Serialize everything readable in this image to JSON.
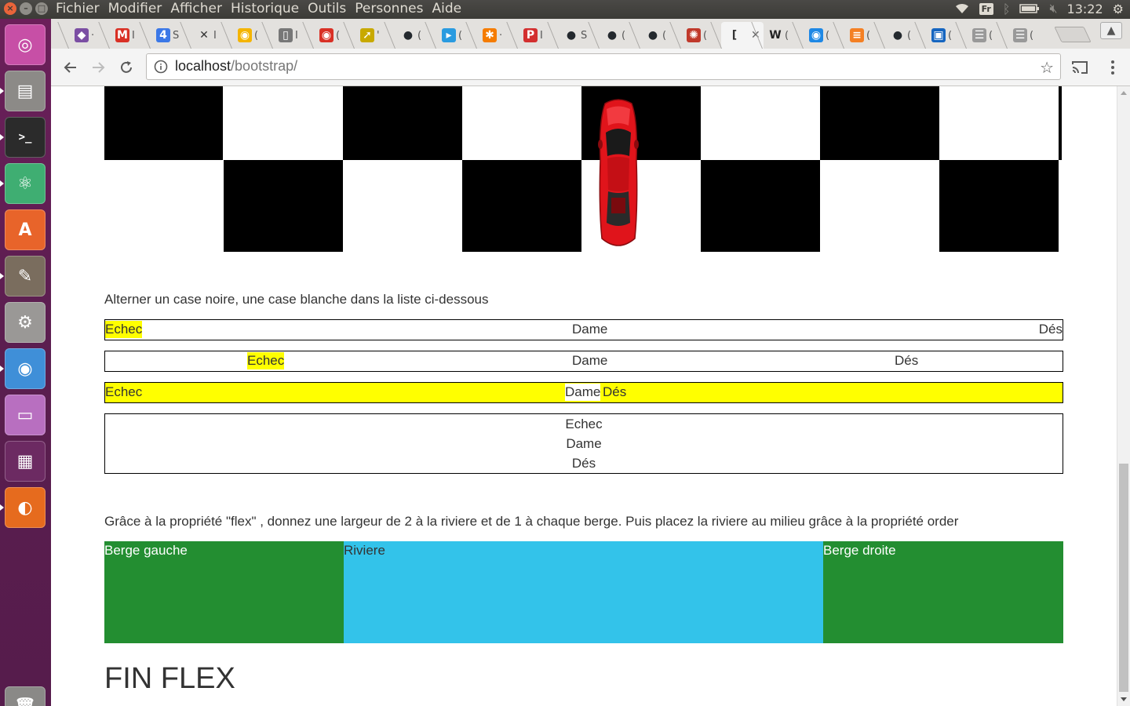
{
  "panel": {
    "menu": [
      "Fichier",
      "Modifier",
      "Afficher",
      "Historique",
      "Outils",
      "Personnes",
      "Aide"
    ],
    "keyboard_layout": "Fr",
    "clock": "13:22"
  },
  "launcher": {
    "apps": [
      {
        "name": "ubuntu-dash",
        "color": "#c74fa6",
        "running": false
      },
      {
        "name": "files",
        "color": "#8c8a87",
        "running": true
      },
      {
        "name": "terminal",
        "color": "#2b2b2b",
        "running": true
      },
      {
        "name": "atom",
        "color": "#3fae72",
        "running": true
      },
      {
        "name": "software-center",
        "color": "#e8642a",
        "running": false
      },
      {
        "name": "gimp",
        "color": "#7a6d5e",
        "running": true
      },
      {
        "name": "system-settings",
        "color": "#9a9896",
        "running": false
      },
      {
        "name": "chromium",
        "color": "#3f8fd8",
        "running": true
      },
      {
        "name": "app-window",
        "color": "#b86fc0",
        "running": false
      },
      {
        "name": "workspace-switcher",
        "color": "#6c2a62",
        "running": false
      },
      {
        "name": "firefox",
        "color": "#e66b1e",
        "running": true
      },
      {
        "name": "trash",
        "color": "#8a8987",
        "running": false
      }
    ]
  },
  "browser": {
    "tabs": [
      {
        "icon": "purple-shield-icon",
        "glyph": "◆",
        "color": "#7b4ea3",
        "cut": "·"
      },
      {
        "icon": "gmail-icon",
        "glyph": "M",
        "color": "#d93025",
        "cut": "I"
      },
      {
        "icon": "calendar-icon",
        "glyph": "4",
        "color": "#3b78e7",
        "cut": "S"
      },
      {
        "icon": "grid-icon",
        "glyph": "✕",
        "color": "#333333",
        "cut": "I"
      },
      {
        "icon": "keep-icon",
        "glyph": "◉",
        "color": "#f4b400",
        "cut": "("
      },
      {
        "icon": "doc-icon",
        "glyph": "▯",
        "color": "#777777",
        "cut": "I"
      },
      {
        "icon": "rss-icon",
        "glyph": "◉",
        "color": "#d93025",
        "cut": "("
      },
      {
        "icon": "rocket-icon",
        "glyph": "➚",
        "color": "#c8a900",
        "cut": "'"
      },
      {
        "icon": "github-icon",
        "glyph": "●",
        "color": "#24292e",
        "cut": "("
      },
      {
        "icon": "cursor-icon",
        "glyph": "▸",
        "color": "#2a9be0",
        "cut": "("
      },
      {
        "icon": "asterisk-icon",
        "glyph": "✱",
        "color": "#f57c00",
        "cut": "·"
      },
      {
        "icon": "p-icon",
        "glyph": "P",
        "color": "#d32f2f",
        "cut": "I"
      },
      {
        "icon": "github-icon",
        "glyph": "●",
        "color": "#24292e",
        "cut": "S"
      },
      {
        "icon": "github-icon",
        "glyph": "●",
        "color": "#24292e",
        "cut": "("
      },
      {
        "icon": "github-icon",
        "glyph": "●",
        "color": "#24292e",
        "cut": "("
      },
      {
        "icon": "cookie-icon",
        "glyph": "✺",
        "color": "#c0392b",
        "cut": "("
      },
      {
        "icon": "bracket-icon",
        "glyph": "[",
        "color": "#333333",
        "cut": "",
        "active": true
      },
      {
        "icon": "wikipedia-icon",
        "glyph": "W",
        "color": "#222222",
        "cut": "("
      },
      {
        "icon": "apk-icon",
        "glyph": "◉",
        "color": "#1e88e5",
        "cut": "("
      },
      {
        "icon": "stackoverflow-icon",
        "glyph": "≡",
        "color": "#f48024",
        "cut": "("
      },
      {
        "icon": "github-icon",
        "glyph": "●",
        "color": "#24292e",
        "cut": "("
      },
      {
        "icon": "box-icon",
        "glyph": "▣",
        "color": "#1565c0",
        "cut": "("
      },
      {
        "icon": "list-icon",
        "glyph": "☰",
        "color": "#999999",
        "cut": "("
      },
      {
        "icon": "list-icon",
        "glyph": "☰",
        "color": "#999999",
        "cut": "("
      }
    ],
    "url_host": "localhost",
    "url_path": "/bootstrap/"
  },
  "page": {
    "instruction_list": "Alterner un case noire, une case blanche dans la liste ci-dessous",
    "row1": [
      "Echec",
      "Dame",
      "Dés"
    ],
    "row2": [
      "Echec",
      "Dame",
      "Dés"
    ],
    "row3": [
      "Echec",
      "Dame",
      "Dés"
    ],
    "row4": [
      "Echec",
      "Dame",
      "Dés"
    ],
    "instruction_flex": "Grâce à la propriété \"flex\" , donnez une largeur de 2 à la riviere et de 1 à chaque berge. Puis placez la riviere au milieu grâce à la propriété order",
    "bank_left": "Berge gauche",
    "river": "Riviere",
    "bank_right": "Berge droite",
    "heading_end": "FIN FLEX"
  }
}
